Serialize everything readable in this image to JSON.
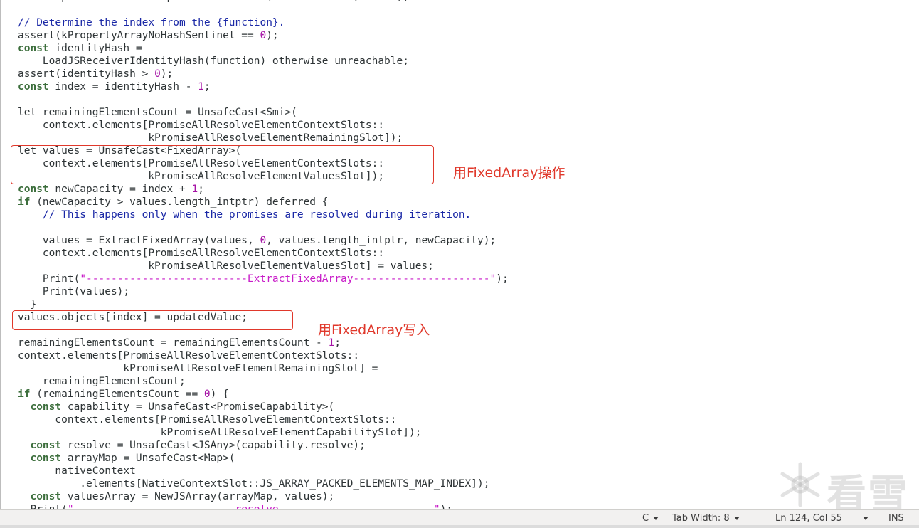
{
  "editor": {
    "lines": [
      [
        [
          "tx",
          "const updatedValue = WrapResolveFunction(nativeContext, value);"
        ]
      ],
      [
        [
          "tx",
          ""
        ]
      ],
      [
        [
          "cm",
          "// Determine the index from the {function}."
        ]
      ],
      [
        [
          "tx",
          "assert(kPropertyArrayNoHashSentinel == "
        ],
        [
          "num",
          "0"
        ],
        [
          "tx",
          ");"
        ]
      ],
      [
        [
          "kw",
          "const"
        ],
        [
          "tx",
          " identityHash ="
        ]
      ],
      [
        [
          "tx",
          "    LoadJSReceiverIdentityHash(function) otherwise unreachable;"
        ]
      ],
      [
        [
          "tx",
          "assert(identityHash > "
        ],
        [
          "num",
          "0"
        ],
        [
          "tx",
          ");"
        ]
      ],
      [
        [
          "kw",
          "const"
        ],
        [
          "tx",
          " index = identityHash - "
        ],
        [
          "num",
          "1"
        ],
        [
          "tx",
          ";"
        ]
      ],
      [
        [
          "tx",
          ""
        ]
      ],
      [
        [
          "tx",
          "let remainingElementsCount = UnsafeCast<Smi>("
        ]
      ],
      [
        [
          "tx",
          "    context.elements[PromiseAllResolveElementContextSlots::"
        ]
      ],
      [
        [
          "tx",
          "                     kPromiseAllResolveElementRemainingSlot]);"
        ]
      ],
      [
        [
          "tx",
          "let values = UnsafeCast<FixedArray>("
        ]
      ],
      [
        [
          "tx",
          "    context.elements[PromiseAllResolveElementContextSlots::"
        ]
      ],
      [
        [
          "tx",
          "                     kPromiseAllResolveElementValuesSlot]);"
        ]
      ],
      [
        [
          "kw",
          "const"
        ],
        [
          "tx",
          " newCapacity = index + "
        ],
        [
          "num",
          "1"
        ],
        [
          "tx",
          ";"
        ]
      ],
      [
        [
          "kw",
          "if"
        ],
        [
          "tx",
          " (newCapacity > values.length_intptr) deferred {"
        ]
      ],
      [
        [
          "tx",
          "    "
        ],
        [
          "cm",
          "// This happens only when the promises are resolved during iteration."
        ]
      ],
      [
        [
          "tx",
          ""
        ]
      ],
      [
        [
          "tx",
          "    values = ExtractFixedArray(values, "
        ],
        [
          "num",
          "0"
        ],
        [
          "tx",
          ", values.length_intptr, newCapacity);"
        ]
      ],
      [
        [
          "tx",
          "    context.elements[PromiseAllResolveElementContextSlots::"
        ]
      ],
      [
        [
          "tx",
          "                     kPromiseAllResolveElementValuesSlot] = values;"
        ]
      ],
      [
        [
          "tx",
          "    Print("
        ],
        [
          "str",
          "\"--------------------------ExtractFixedArray----------------------\""
        ],
        [
          "tx",
          ");"
        ]
      ],
      [
        [
          "tx",
          "    Print(values);"
        ]
      ],
      [
        [
          "tx",
          "  }"
        ]
      ],
      [
        [
          "tx",
          "values.objects[index] = updatedValue;"
        ]
      ],
      [
        [
          "tx",
          ""
        ]
      ],
      [
        [
          "tx",
          "remainingElementsCount = remainingElementsCount - "
        ],
        [
          "num",
          "1"
        ],
        [
          "tx",
          ";"
        ]
      ],
      [
        [
          "tx",
          "context.elements[PromiseAllResolveElementContextSlots::"
        ]
      ],
      [
        [
          "tx",
          "                 kPromiseAllResolveElementRemainingSlot] ="
        ]
      ],
      [
        [
          "tx",
          "    remainingElementsCount;"
        ]
      ],
      [
        [
          "kw",
          "if"
        ],
        [
          "tx",
          " (remainingElementsCount == "
        ],
        [
          "num",
          "0"
        ],
        [
          "tx",
          ") {"
        ]
      ],
      [
        [
          "tx",
          "  "
        ],
        [
          "kw",
          "const"
        ],
        [
          "tx",
          " capability = UnsafeCast<PromiseCapability>("
        ]
      ],
      [
        [
          "tx",
          "      context.elements[PromiseAllResolveElementContextSlots::"
        ]
      ],
      [
        [
          "tx",
          "                       kPromiseAllResolveElementCapabilitySlot]);"
        ]
      ],
      [
        [
          "tx",
          "  "
        ],
        [
          "kw",
          "const"
        ],
        [
          "tx",
          " resolve = UnsafeCast<JSAny>(capability.resolve);"
        ]
      ],
      [
        [
          "tx",
          "  "
        ],
        [
          "kw",
          "const"
        ],
        [
          "tx",
          " arrayMap = UnsafeCast<Map>("
        ]
      ],
      [
        [
          "tx",
          "      nativeContext"
        ]
      ],
      [
        [
          "tx",
          "          .elements[NativeContextSlot::JS_ARRAY_PACKED_ELEMENTS_MAP_INDEX]);"
        ]
      ],
      [
        [
          "tx",
          "  "
        ],
        [
          "kw",
          "const"
        ],
        [
          "tx",
          " valuesArray = NewJSArray(arrayMap, values);"
        ]
      ],
      [
        [
          "tx",
          "  Print("
        ],
        [
          "str",
          "\"--------------------------resolve-------------------------\""
        ],
        [
          "tx",
          ");"
        ]
      ]
    ]
  },
  "annotations": [
    {
      "label": "用FixedArray操作"
    },
    {
      "label": "用FixedArray写入"
    }
  ],
  "watermark": {
    "text": "看雪"
  },
  "statusbar": {
    "language": "C",
    "tab_width": "Tab Width: 8",
    "cursor": "Ln 124, Col 55",
    "mode": "INS"
  },
  "colors": {
    "annotation": "#e0382b",
    "keyword": "#3c6e3c",
    "number": "#a512a5",
    "string": "#c81cc8",
    "comment": "#1a28a6"
  }
}
